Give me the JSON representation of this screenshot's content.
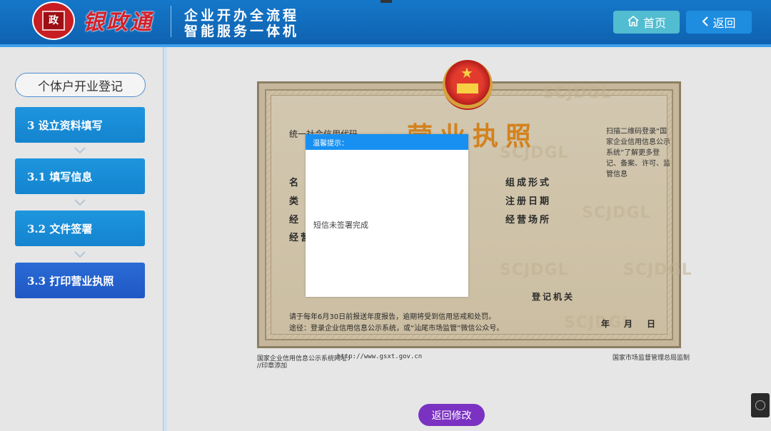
{
  "header": {
    "logo_char": "政",
    "brand": "银政通",
    "slogan_line1": "企业开办全流程",
    "slogan_line2": "智能服务一体机",
    "home_label": "首页",
    "back_label": "返回",
    "accent": "#1577c9"
  },
  "sidebar": {
    "title": "个体户开业登记",
    "steps": [
      {
        "label": "3 设立资料填写"
      },
      {
        "label": "3.1 填写信息"
      },
      {
        "label": "3.2 文件签署"
      },
      {
        "label": "3.3 打印营业执照"
      }
    ]
  },
  "certificate": {
    "title": "营业执照",
    "credit_code_label": "统一社会信用代码",
    "fields_left": [
      "名",
      "类",
      "经",
      "经营"
    ],
    "fields_right": [
      "组成形式",
      "注册日期",
      "经营场所"
    ],
    "qr_note": "扫描二维码登录“国家企业信用信息公示系统”了解更多登记、备案、许可、监管信息",
    "registration_authority": "登记机关",
    "date_labels": [
      "年",
      "月",
      "日"
    ],
    "notice_line1": "请于每年6月30日前报送年度报告，逾期将受到信用惩戒和处罚。",
    "notice_line2": "途径：登录企业信用信息公示系统，或“汕尾市场监管”微信公众号。",
    "watermark": "SCJDGL",
    "footer_left": "国家企业信用信息公示系统网址：",
    "footer_url": "http://www.gsxt.gov.cn",
    "footer_left2": "//印章添加",
    "footer_right": "国家市场监督管理总局监制"
  },
  "modal": {
    "title": "温馨提示：",
    "message": "短信未签署完成"
  },
  "bottom": {
    "edit_label": "返回修改"
  }
}
